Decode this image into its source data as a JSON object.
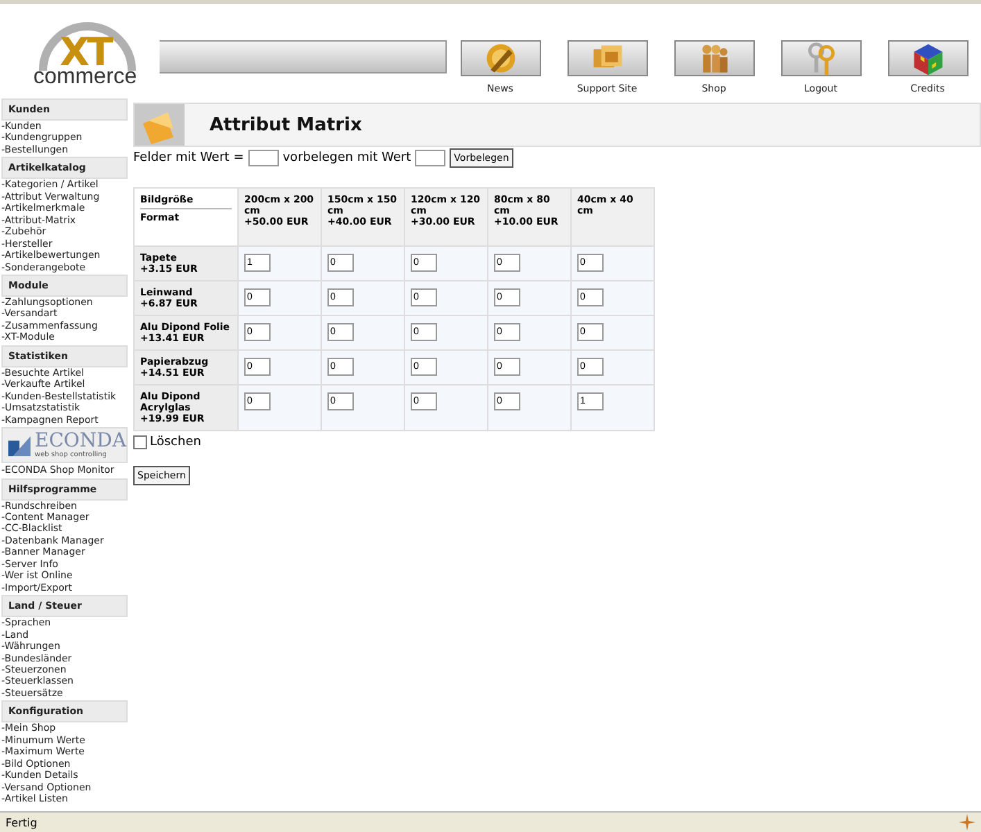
{
  "logo": {
    "mark": "XT",
    "name": "commerce"
  },
  "toolbar": [
    {
      "kind": "news",
      "label": "News"
    },
    {
      "kind": "support",
      "label": "Support Site"
    },
    {
      "kind": "shop",
      "label": "Shop"
    },
    {
      "kind": "logout",
      "label": "Logout"
    },
    {
      "kind": "credits",
      "label": "Credits"
    }
  ],
  "sidebar": [
    {
      "kind": "section",
      "title": "Kunden",
      "items": [
        "-Kunden",
        "-Kundengruppen",
        "-Bestellungen"
      ]
    },
    {
      "kind": "section",
      "title": "Artikelkatalog",
      "items": [
        "-Kategorien / Artikel",
        "-Attribut Verwaltung",
        "-Artikelmerkmale",
        "-Attribut-Matrix",
        "-Zubehör",
        "-Hersteller",
        "-Artikelbewertungen",
        "-Sonderangebote"
      ]
    },
    {
      "kind": "section",
      "title": "Module",
      "items": [
        "-Zahlungsoptionen",
        "-Versandart",
        "-Zusammenfassung",
        "-XT-Module"
      ]
    },
    {
      "kind": "section",
      "title": "Statistiken",
      "items": [
        "-Besuchte Artikel",
        "-Verkaufte Artikel",
        "-Kunden-Bestellstatistik",
        "-Umsatzstatistik",
        "-Kampagnen Report"
      ]
    },
    {
      "kind": "banner",
      "title": "ECONDA",
      "subtitle": "web shop controlling",
      "items": [
        "-ECONDA Shop Monitor"
      ]
    },
    {
      "kind": "section",
      "title": "Hilfsprogramme",
      "items": [
        "-Rundschreiben",
        "-Content Manager",
        "-CC-Blacklist",
        "-Datenbank Manager",
        "-Banner Manager",
        "-Server Info",
        "-Wer ist Online",
        "-Import/Export"
      ]
    },
    {
      "kind": "section",
      "title": "Land / Steuer",
      "items": [
        "-Sprachen",
        "-Land",
        "-Währungen",
        "-Bundesländer",
        "-Steuerzonen",
        "-Steuerklassen",
        "-Steuersätze"
      ]
    },
    {
      "kind": "section",
      "title": "Konfiguration",
      "items": [
        "-Mein Shop",
        "-Minumum Werte",
        "-Maximum Werte",
        "-Bild Optionen",
        "-Kunden Details",
        "-Versand Optionen",
        "-Artikel Listen"
      ]
    }
  ],
  "page": {
    "title": "Attribut Matrix"
  },
  "prefill": {
    "label_1": "Felder mit Wert =",
    "label_2": "vorbelegen mit Wert",
    "button": "Vorbelegen"
  },
  "matrix": {
    "corner": [
      "Bildgröße",
      "Format"
    ],
    "columns": [
      [
        "200cm x 200 cm",
        "+50.00 EUR"
      ],
      [
        "150cm x 150 cm",
        "+40.00 EUR"
      ],
      [
        "120cm x 120 cm",
        "+30.00 EUR"
      ],
      [
        "80cm x 80 cm",
        "+10.00 EUR"
      ],
      [
        "40cm x 40 cm"
      ]
    ],
    "rows": [
      {
        "label": [
          "Tapete",
          "+3.15 EUR"
        ],
        "values": [
          "1",
          "0",
          "0",
          "0",
          "0"
        ]
      },
      {
        "label": [
          "Leinwand",
          "+6.87 EUR"
        ],
        "values": [
          "0",
          "0",
          "0",
          "0",
          "0"
        ]
      },
      {
        "label": [
          "Alu Dipond Folie",
          "+13.41 EUR"
        ],
        "values": [
          "0",
          "0",
          "0",
          "0",
          "0"
        ]
      },
      {
        "label": [
          "Papierabzug",
          "+14.51 EUR"
        ],
        "values": [
          "0",
          "0",
          "0",
          "0",
          "0"
        ]
      },
      {
        "label": [
          "Alu Dipond Acrylglas",
          "+19.99 EUR"
        ],
        "values": [
          "0",
          "0",
          "0",
          "0",
          "1"
        ]
      }
    ]
  },
  "delete": {
    "label": "Löschen",
    "checked": false
  },
  "save_button": "Speichern",
  "status_bar": "Fertig"
}
